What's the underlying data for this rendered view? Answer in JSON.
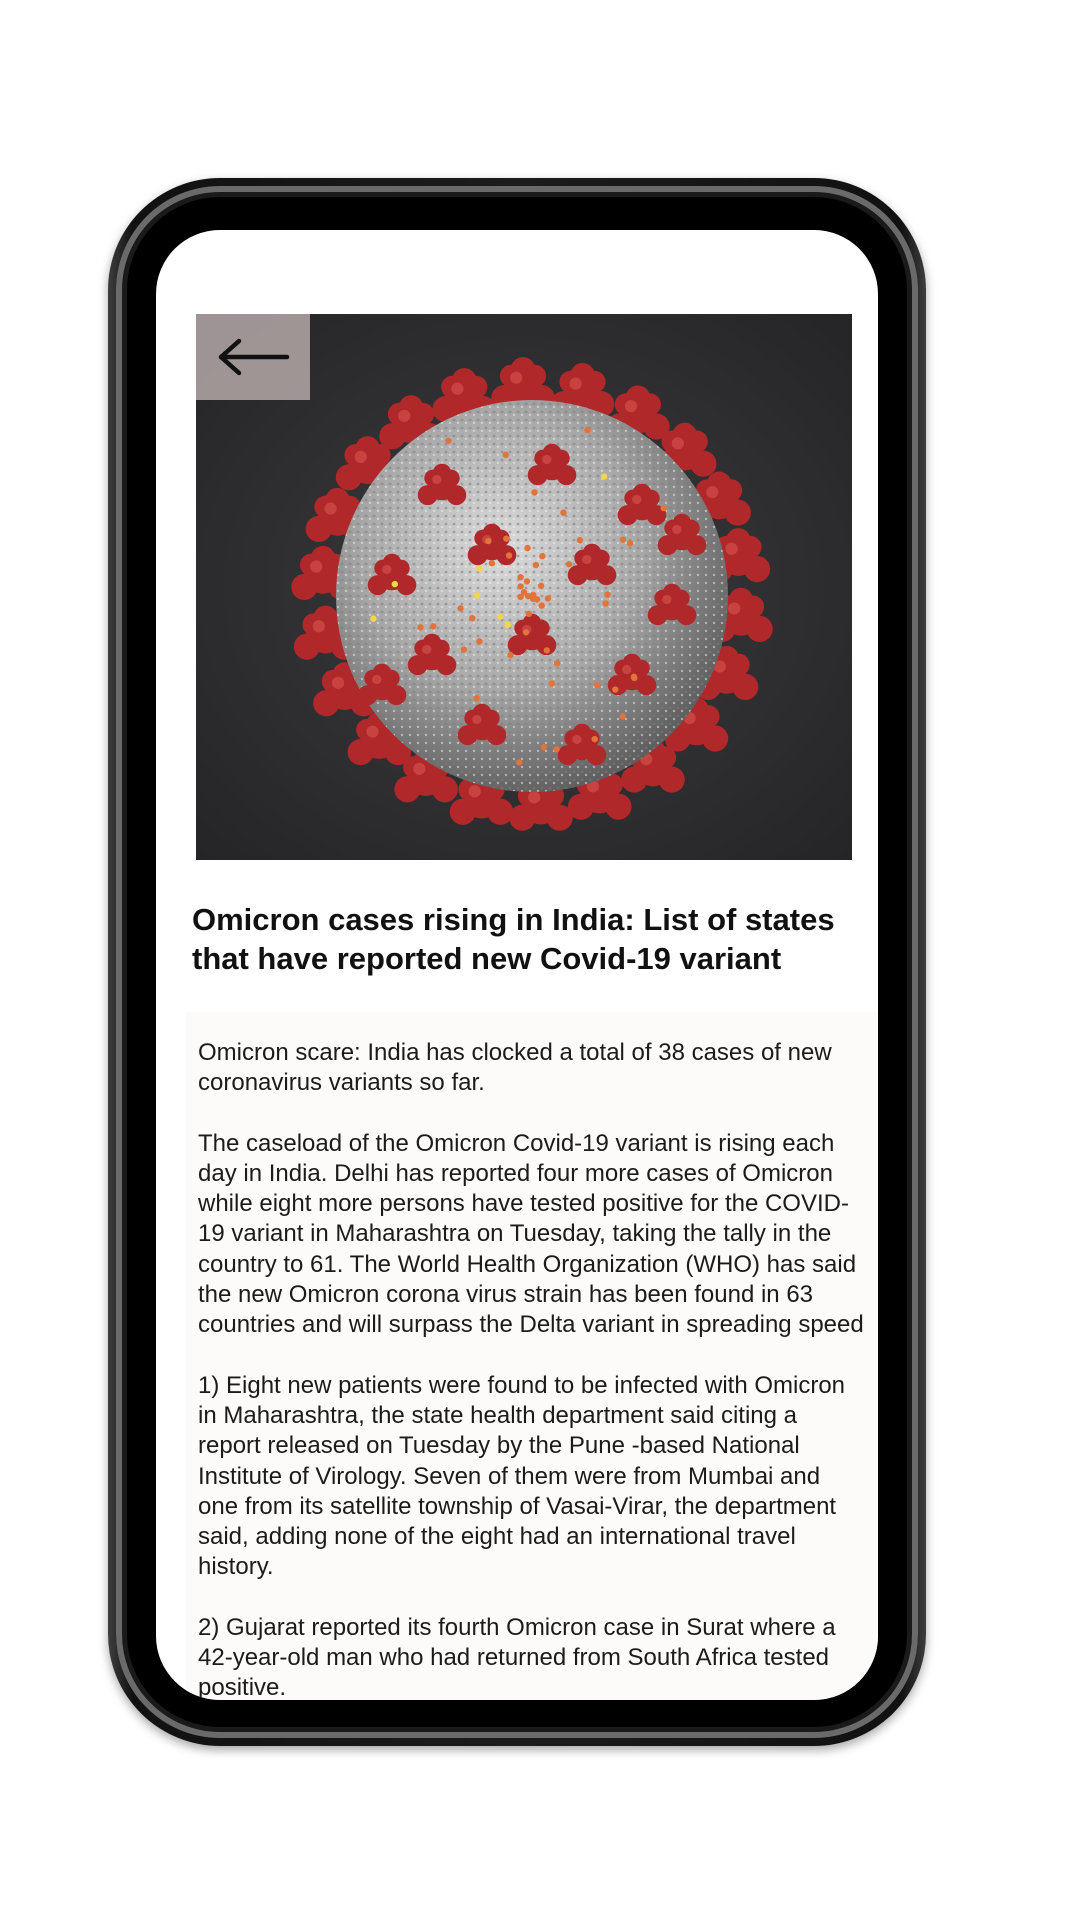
{
  "article": {
    "back_icon": "arrow-left-icon",
    "hero_image": "coronavirus-illustration",
    "title": "Omicron cases rising in India: List of states that have reported new Covid-19 variant",
    "paragraphs": [
      "Omicron scare: India has clocked a total of 38 cases of new coronavirus variants so far.",
      "The caseload of the Omicron Covid-19 variant is rising each day in India. Delhi has reported four more cases of Omicron while eight more persons have tested positive for the COVID-19 variant in Maharashtra on Tuesday, taking the tally in the country to 61. The World Health Organization (WHO) has said the new Omicron corona virus strain has been found in 63 countries and will surpass the Delta variant in spreading speed",
      "1) Eight new patients were found to be infected with Omicron in Maharashtra, the state health department said citing a report released on Tuesday by the Pune -based National Institute of Virology. Seven of them were from Mumbai and one from its satellite township of Vasai-Virar, the department said, adding none of the eight had an international travel history.",
      "2) Gujarat reported its fourth Omicron case in Surat where a 42-year-old man who had returned from South Africa tested positive."
    ]
  },
  "colors": {
    "spike": "#b0282a",
    "virus_body": "#b9b9b9",
    "background": "#2e2e31"
  }
}
